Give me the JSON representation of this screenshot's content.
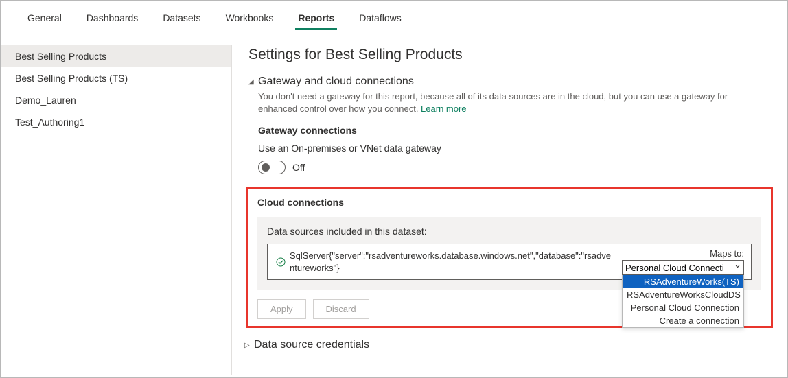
{
  "tabs": [
    "General",
    "Dashboards",
    "Datasets",
    "Workbooks",
    "Reports",
    "Dataflows"
  ],
  "tabs_active_index": 4,
  "sidebar": {
    "items": [
      "Best Selling Products",
      "Best Selling Products (TS)",
      "Demo_Lauren",
      "Test_Authoring1"
    ],
    "selected_index": 0
  },
  "page_title": "Settings for Best Selling Products",
  "gateway_section": {
    "title": "Gateway and cloud connections",
    "desc": "You don't need a gateway for this report, because all of its data sources are in the cloud, but you can use a gateway for enhanced control over how you connect. ",
    "learn_more": "Learn more",
    "conn_title": "Gateway connections",
    "use_label": "Use an On-premises or VNet data gateway",
    "toggle_state": "Off"
  },
  "cloud_section": {
    "title": "Cloud connections",
    "panel_label": "Data sources included in this dataset:",
    "datasource": "SqlServer{\"server\":\"rsadventureworks.database.windows.net\",\"database\":\"rsadventureworks\"}",
    "maps_to_label": "Maps to:",
    "maps_to_value": "Personal Cloud Connecti",
    "dropdown_options": [
      "RSAdventureWorks(TS)",
      "RSAdventureWorksCloudDS",
      "Personal Cloud Connection",
      "Create a connection"
    ],
    "dropdown_highlight_index": 0,
    "buttons": {
      "apply": "Apply",
      "discard": "Discard"
    }
  },
  "credentials_section": {
    "title": "Data source credentials"
  }
}
